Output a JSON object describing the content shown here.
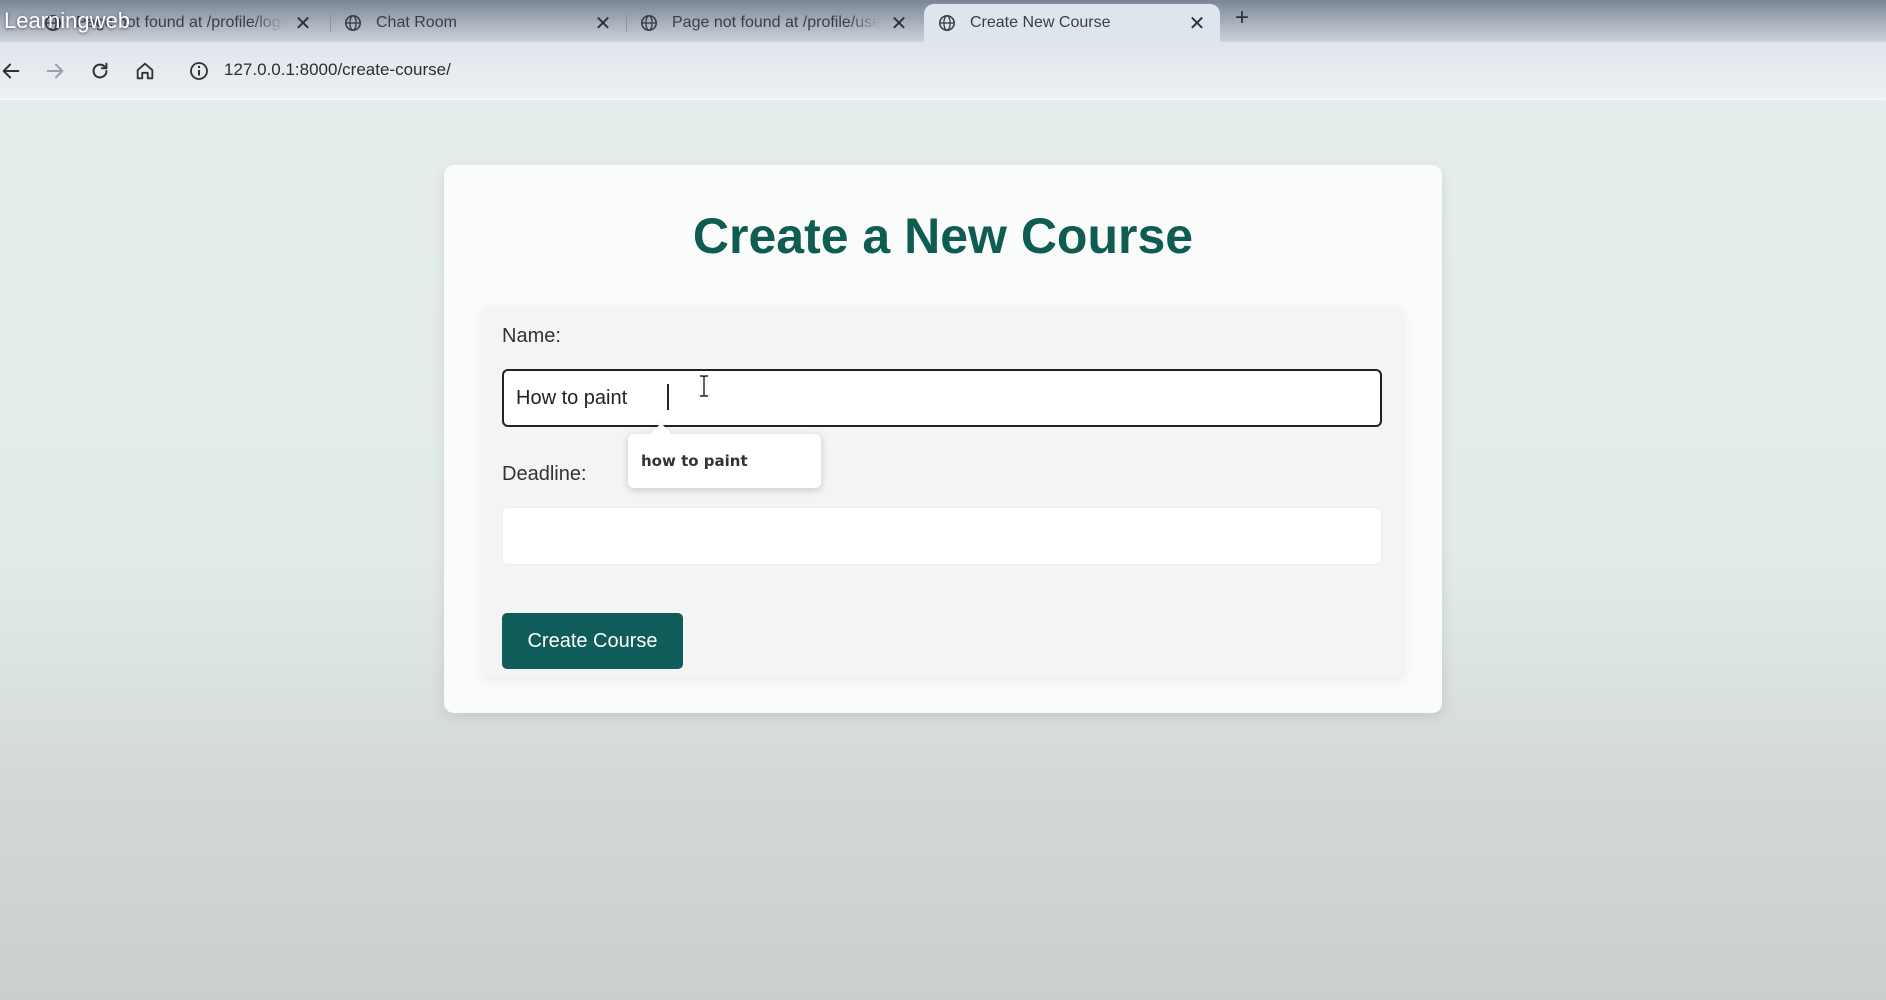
{
  "video_overlay": {
    "title": "Learningweb"
  },
  "browser": {
    "tabs": [
      {
        "label": "Page not found at /profile/logout",
        "active": false
      },
      {
        "label": "Chat Room",
        "active": false
      },
      {
        "label": "Page not found at /profile/user",
        "active": false
      },
      {
        "label": "Create New Course",
        "active": true
      }
    ],
    "new_tab_icon": "plus-icon",
    "address_bar": {
      "url": "127.0.0.1:8000/create-course/"
    }
  },
  "page": {
    "heading": "Create a New Course",
    "form": {
      "name_label": "Name:",
      "name_value": "How to paint",
      "autocomplete_suggestion": "how to paint",
      "deadline_label": "Deadline:",
      "deadline_value": "",
      "submit_label": "Create Course"
    }
  },
  "colors": {
    "accent": "#0f5c5a",
    "heading": "#0f5c52",
    "page_background": "#e6efee"
  }
}
